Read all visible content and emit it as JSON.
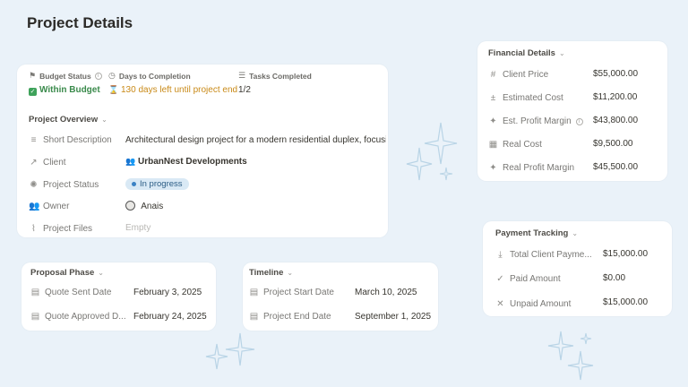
{
  "page": {
    "title": "Project Details"
  },
  "top_stats": {
    "budget_status": {
      "label": "Budget Status",
      "value": "Within Budget"
    },
    "days_to_completion": {
      "label": "Days to Completion",
      "value": "130 days left until project end"
    },
    "tasks_completed": {
      "label": "Tasks Completed",
      "value": "1/2"
    }
  },
  "overview": {
    "title": "Project Overview",
    "rows": [
      {
        "label": "Short Description",
        "value": "Architectural design project for a modern residential duplex, focusing on"
      },
      {
        "label": "Client",
        "value": "UrbanNest Developments"
      },
      {
        "label": "Project Status",
        "value": "In progress"
      },
      {
        "label": "Owner",
        "value": "Anais"
      },
      {
        "label": "Project Files",
        "value": "Empty"
      }
    ]
  },
  "proposal": {
    "title": "Proposal Phase",
    "rows": [
      {
        "label": "Quote Sent Date",
        "value": "February 3, 2025"
      },
      {
        "label": "Quote Approved D...",
        "value": "February 24, 2025"
      }
    ]
  },
  "timeline": {
    "title": "Timeline",
    "rows": [
      {
        "label": "Project Start Date",
        "value": "March 10, 2025"
      },
      {
        "label": "Project End Date",
        "value": "September 1, 2025"
      }
    ]
  },
  "financial": {
    "title": "Financial Details",
    "rows": [
      {
        "label": "Client Price",
        "value": "$55,000.00"
      },
      {
        "label": "Estimated Cost",
        "value": "$11,200.00"
      },
      {
        "label": "Est. Profit Margin",
        "value": "$43,800.00"
      },
      {
        "label": "Real Cost",
        "value": "$9,500.00"
      },
      {
        "label": "Real Profit Margin",
        "value": "$45,500.00"
      }
    ]
  },
  "payment": {
    "title": "Payment Tracking",
    "rows": [
      {
        "label": "Total Client Payme...",
        "value": "$15,000.00"
      },
      {
        "label": "Paid Amount",
        "value": "$0.00"
      },
      {
        "label": "Unpaid Amount",
        "value": "$15,000.00"
      }
    ]
  },
  "colors": {
    "background": "#eaf2f9",
    "within_budget": "#3a8a4b",
    "days_left": "#c98a18",
    "status_pill": "#d9e9f5"
  }
}
